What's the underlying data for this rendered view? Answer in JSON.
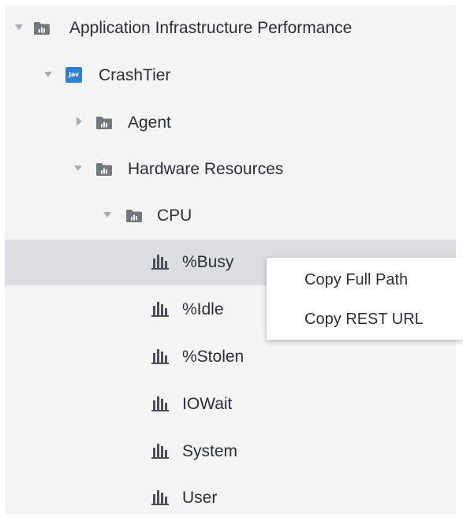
{
  "tree": {
    "root": {
      "label": "Application Infrastructure Performance",
      "expanded": true,
      "icon": "folder-icon"
    },
    "tier": {
      "label": "CrashTier",
      "expanded": true,
      "icon": "java-icon",
      "icon_text": "Jav"
    },
    "folders": [
      {
        "label": "Agent",
        "expanded": false,
        "icon": "folder-icon"
      },
      {
        "label": "Hardware Resources",
        "expanded": true,
        "icon": "folder-icon"
      },
      {
        "label": "CPU",
        "expanded": true,
        "icon": "folder-icon"
      }
    ],
    "metrics": [
      {
        "label": "%Busy",
        "icon": "bar-chart-icon",
        "selected": true
      },
      {
        "label": "%Idle",
        "icon": "bar-chart-icon",
        "selected": false
      },
      {
        "label": "%Stolen",
        "icon": "bar-chart-icon",
        "selected": false
      },
      {
        "label": "IOWait",
        "icon": "bar-chart-icon",
        "selected": false
      },
      {
        "label": "System",
        "icon": "bar-chart-icon",
        "selected": false
      },
      {
        "label": "User",
        "icon": "bar-chart-icon",
        "selected": false
      }
    ]
  },
  "context_menu": {
    "items": [
      {
        "label": "Copy Full Path"
      },
      {
        "label": "Copy REST URL"
      }
    ]
  },
  "colors": {
    "panel_background": "#f4f4f5",
    "selected_row": "#dcdde0",
    "toggle_arrow": "#a9acb2",
    "folder_icon": "#75787d",
    "java_icon": "#2f7fd6",
    "metric_icon": "#4b4f55",
    "text": "#2b2f36"
  }
}
